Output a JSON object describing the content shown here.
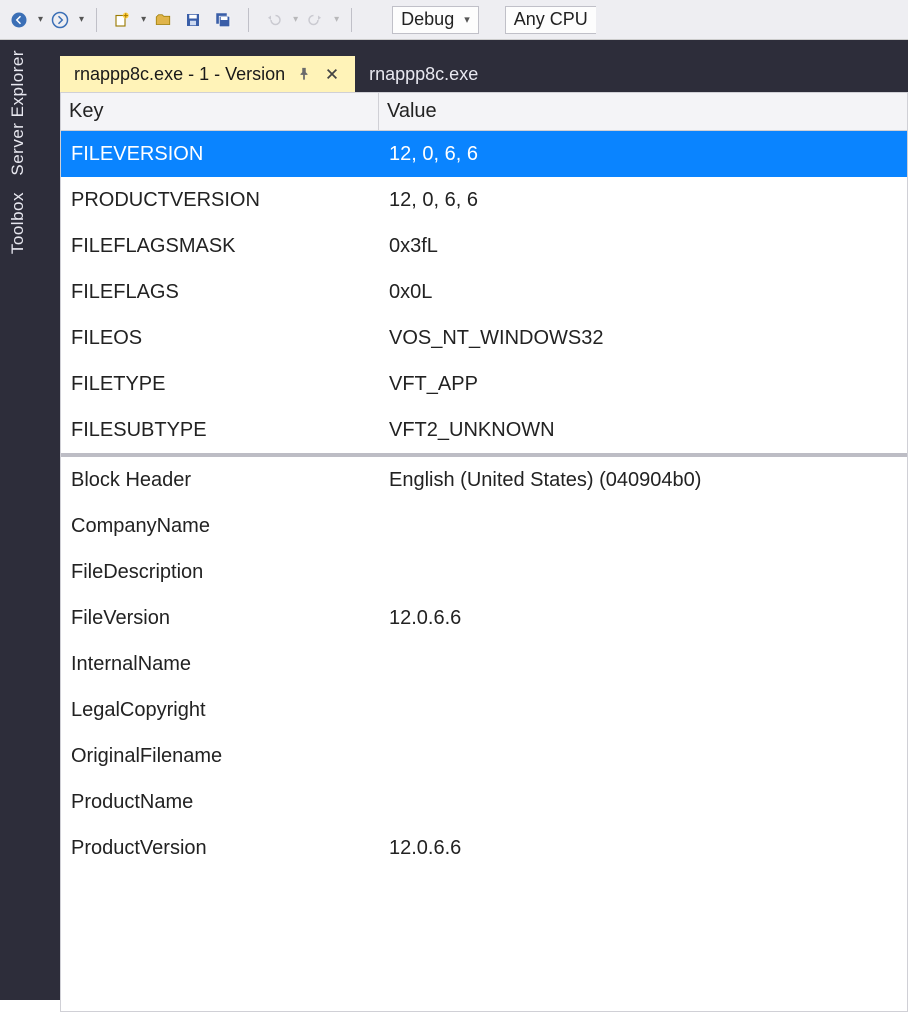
{
  "toolbar": {
    "config_label": "Debug",
    "platform_label": "Any CPU"
  },
  "side_rail": {
    "items": [
      "Server Explorer",
      "Toolbox"
    ]
  },
  "tabs": [
    {
      "label": "rnappp8c.exe - 1 - Version",
      "active": true
    },
    {
      "label": "rnappp8c.exe",
      "active": false
    }
  ],
  "table": {
    "headers": {
      "key": "Key",
      "value": "Value"
    },
    "section1": [
      {
        "key": "FILEVERSION",
        "value": "12, 0, 6, 6",
        "selected": true
      },
      {
        "key": "PRODUCTVERSION",
        "value": "12, 0, 6, 6"
      },
      {
        "key": "FILEFLAGSMASK",
        "value": "0x3fL"
      },
      {
        "key": "FILEFLAGS",
        "value": "0x0L"
      },
      {
        "key": "FILEOS",
        "value": "VOS_NT_WINDOWS32"
      },
      {
        "key": "FILETYPE",
        "value": "VFT_APP"
      },
      {
        "key": "FILESUBTYPE",
        "value": "VFT2_UNKNOWN"
      }
    ],
    "section2": [
      {
        "key": "Block Header",
        "value": "English (United States) (040904b0)"
      },
      {
        "key": "CompanyName",
        "value": ""
      },
      {
        "key": "FileDescription",
        "value": ""
      },
      {
        "key": "FileVersion",
        "value": "12.0.6.6"
      },
      {
        "key": "InternalName",
        "value": ""
      },
      {
        "key": "LegalCopyright",
        "value": ""
      },
      {
        "key": "OriginalFilename",
        "value": ""
      },
      {
        "key": "ProductName",
        "value": ""
      },
      {
        "key": "ProductVersion",
        "value": "12.0.6.6"
      }
    ]
  }
}
